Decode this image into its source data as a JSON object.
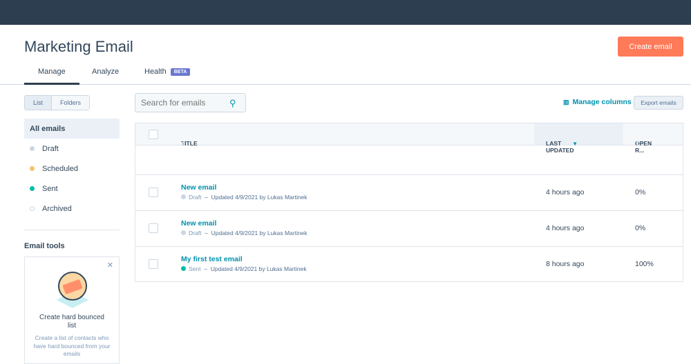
{
  "header": {
    "title": "Marketing Email",
    "create_label": "Create email"
  },
  "tabs": [
    {
      "label": "Manage"
    },
    {
      "label": "Analyze"
    },
    {
      "label": "Health",
      "badge": "BETA"
    }
  ],
  "view_toggle": {
    "list": "List",
    "folders": "Folders"
  },
  "sidebar": {
    "items": [
      {
        "label": "All emails"
      },
      {
        "label": "Draft",
        "color": "#cbd6e2"
      },
      {
        "label": "Scheduled",
        "color": "#f5c26b"
      },
      {
        "label": "Sent",
        "color": "#00bda5"
      },
      {
        "label": "Archived",
        "color": "#ffffff"
      }
    ]
  },
  "email_tools": {
    "heading": "Email tools",
    "card_title": "Create hard bounced list",
    "card_desc": "Create a list of contacts who have hard bounced from your emails"
  },
  "search": {
    "placeholder": "Search for emails"
  },
  "toolbar": {
    "manage_columns": "Manage columns",
    "export": "Export emails"
  },
  "table": {
    "columns": [
      "TITLE",
      "LAST UPDATED",
      "OPEN R..."
    ],
    "rows": [
      {
        "title": "New email",
        "status": "Draft",
        "status_color": "#cbd6e2",
        "updated": "Updated 4/9/2021 by Lukas Martinek",
        "last": "4 hours ago",
        "open": "0%"
      },
      {
        "title": "New email",
        "status": "Draft",
        "status_color": "#cbd6e2",
        "updated": "Updated 4/9/2021 by Lukas Martinek",
        "last": "4 hours ago",
        "open": "0%"
      },
      {
        "title": "My first test email",
        "status": "Sent",
        "status_color": "#00bda5",
        "updated": "Updated 4/9/2021 by Lukas Martinek",
        "last": "8 hours ago",
        "open": "100%"
      }
    ]
  }
}
